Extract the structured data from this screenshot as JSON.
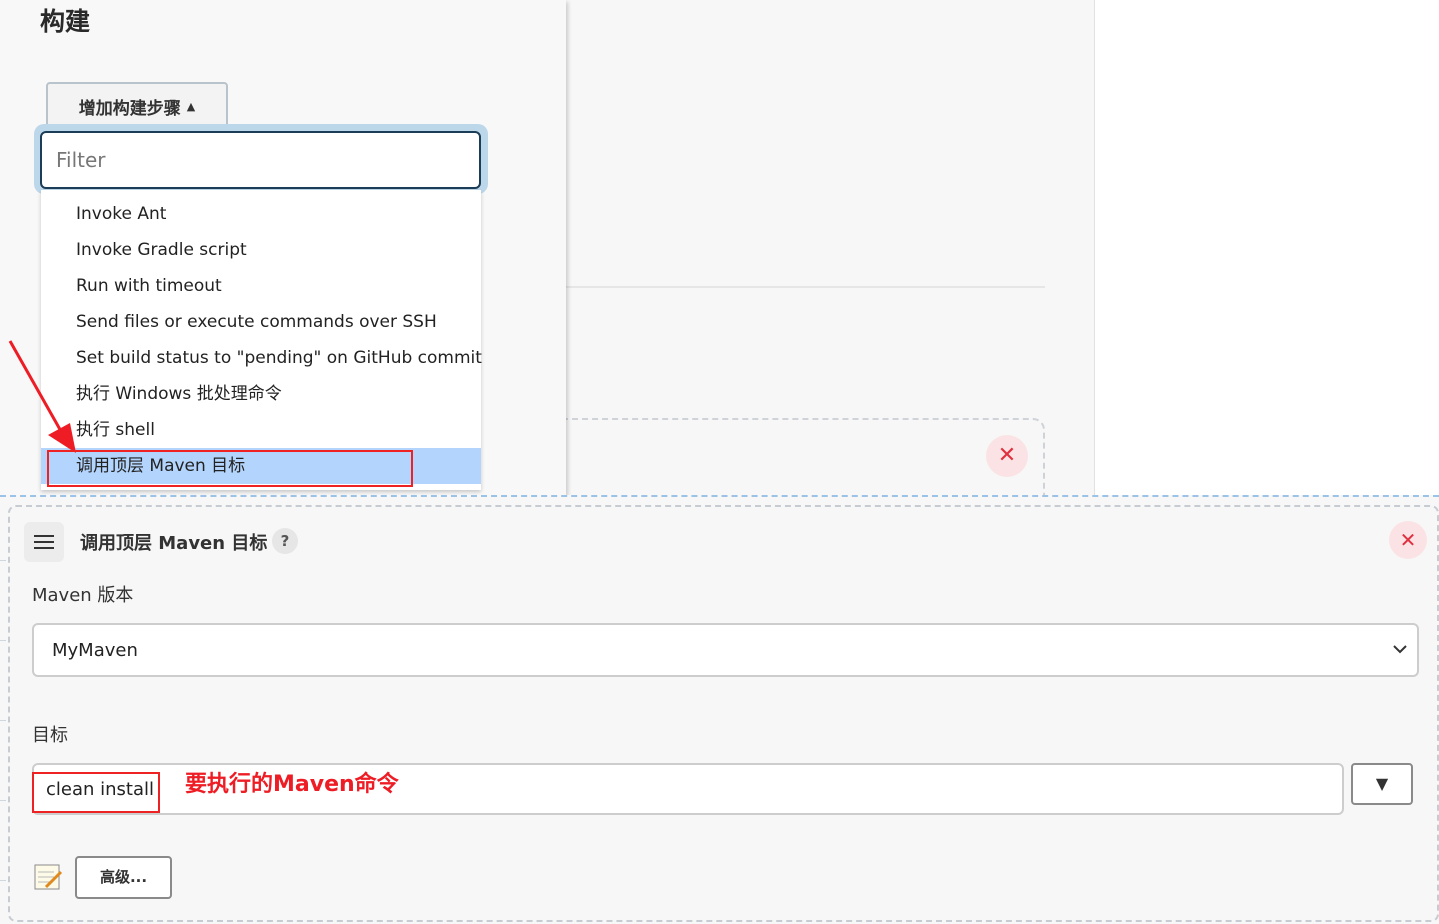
{
  "build": {
    "title": "构建",
    "add_step_label": "增加构建步骤",
    "filter_placeholder": "Filter",
    "menu_items": [
      "Invoke Ant",
      "Invoke Gradle script",
      "Run with timeout",
      "Send files or execute commands over SSH",
      "Set build status to \"pending\" on GitHub commit",
      "执行 Windows 批处理命令",
      "执行 shell",
      "调用顶层 Maven 目标"
    ],
    "selected_item": "调用顶层 Maven 目标"
  },
  "step": {
    "title": "调用顶层 Maven 目标",
    "help": "?",
    "close": "✕",
    "maven_version_label": "Maven 版本",
    "maven_version_value": "MyMaven",
    "goals_label": "目标",
    "goals_value": "clean install",
    "goals_annotation": "要执行的Maven命令",
    "expand": "▼",
    "advanced_label": "高级..."
  },
  "background": {
    "close": "✕"
  },
  "colors": {
    "annotation_red": "#ee1c24",
    "selection_blue": "#b3d4fc",
    "close_red": "#e0303f",
    "focus_border": "#1c3d57"
  }
}
